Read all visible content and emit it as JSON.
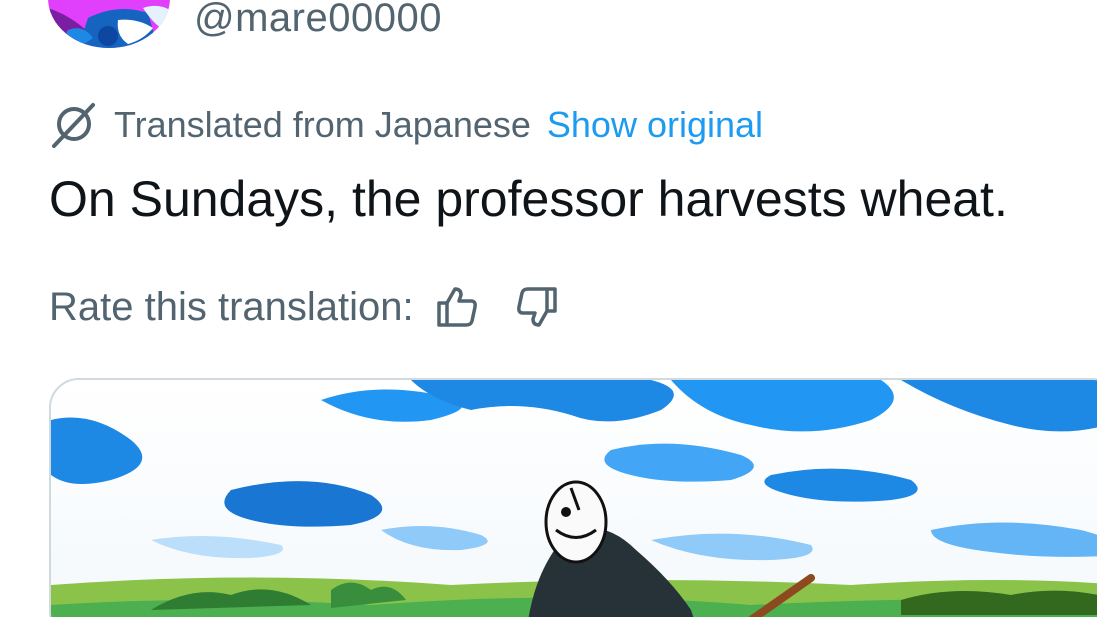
{
  "author": {
    "handle": "@mare00000"
  },
  "translation": {
    "label": "Translated from Japanese",
    "show_original": "Show original"
  },
  "tweet": {
    "text": "On Sundays, the professor harvests wheat."
  },
  "rating": {
    "label": "Rate this translation:",
    "thumbs_up_icon": "thumbs-up-icon",
    "thumbs_down_icon": "thumbs-down-icon"
  },
  "colors": {
    "text_primary": "#0f1419",
    "text_secondary": "#536471",
    "link": "#1d9bf0",
    "border": "#cfd9de"
  }
}
